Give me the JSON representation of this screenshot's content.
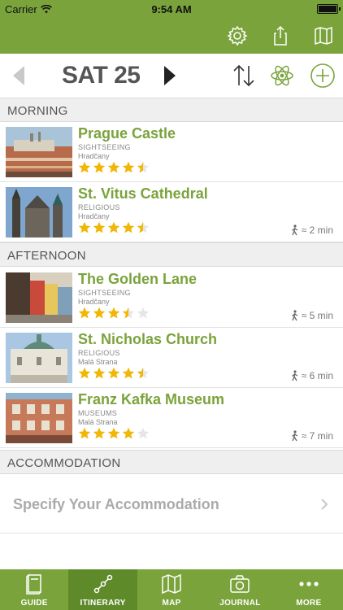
{
  "status_bar": {
    "carrier": "Carrier",
    "time": "9:54 AM"
  },
  "day_nav": {
    "day": "SAT 25"
  },
  "sections": [
    {
      "title": "MORNING",
      "places": [
        {
          "name": "Prague Castle",
          "category": "SIGHTSEEING",
          "district": "Hradčany",
          "rating": 4.5,
          "walk": ""
        },
        {
          "name": "St. Vitus Cathedral",
          "category": "RELIGIOUS",
          "district": "Hradčany",
          "rating": 4.5,
          "walk": "≈ 2 min"
        }
      ]
    },
    {
      "title": "AFTERNOON",
      "places": [
        {
          "name": "The Golden Lane",
          "category": "SIGHTSEEING",
          "district": "Hradčany",
          "rating": 3.5,
          "walk": "≈ 5 min"
        },
        {
          "name": "St. Nicholas Church",
          "category": "RELIGIOUS",
          "district": "Malá Strana",
          "rating": 4.5,
          "walk": "≈ 6 min"
        },
        {
          "name": "Franz Kafka Museum",
          "category": "MUSEUMS",
          "district": "Malá Strana",
          "rating": 4,
          "walk": "≈ 7 min"
        }
      ]
    },
    {
      "title": "ACCOMMODATION",
      "places": []
    }
  ],
  "accommodation": {
    "label": "Specify Your Accommodation"
  },
  "tabs": [
    {
      "label": "GUIDE",
      "icon": "book-icon",
      "active": false
    },
    {
      "label": "ITINERARY",
      "icon": "route-icon",
      "active": true
    },
    {
      "label": "MAP",
      "icon": "map-icon",
      "active": false
    },
    {
      "label": "JOURNAL",
      "icon": "camera-icon",
      "active": false
    },
    {
      "label": "MORE",
      "icon": "more-icon",
      "active": false
    }
  ],
  "colors": {
    "accent": "#7aa33b",
    "accent_dark": "#5f8a2a",
    "star": "#f2b705",
    "star_empty": "#e6e6e6"
  }
}
